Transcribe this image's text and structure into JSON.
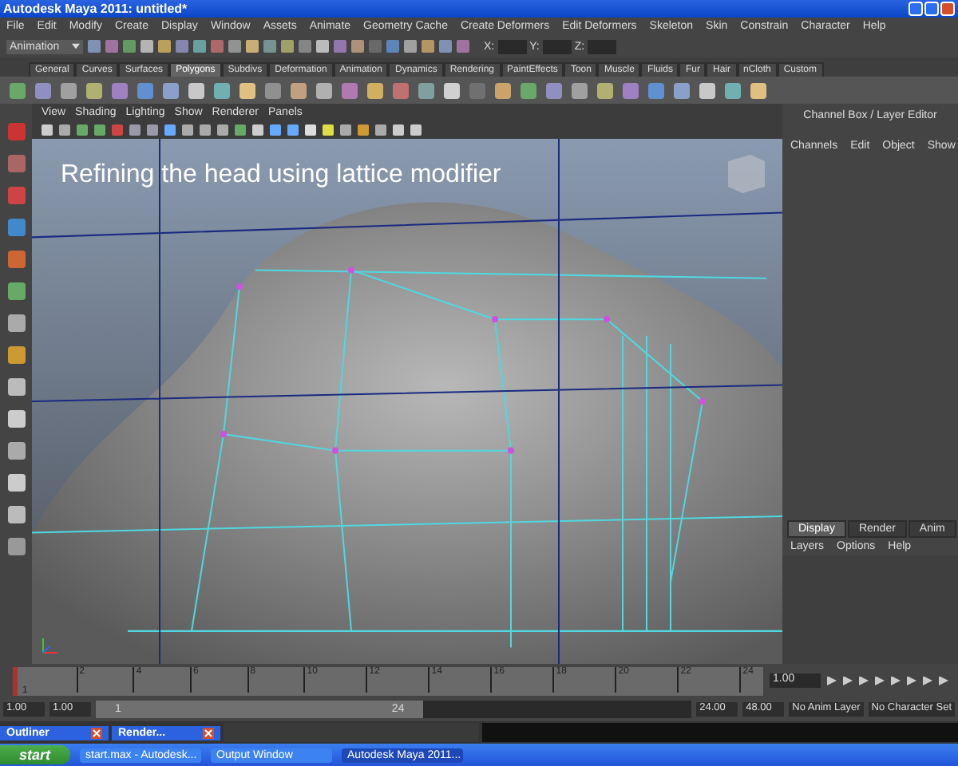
{
  "window": {
    "title": "Autodesk Maya 2011: untitled*"
  },
  "menu": [
    "File",
    "Edit",
    "Modify",
    "Create",
    "Display",
    "Window",
    "Assets",
    "Animate",
    "Geometry Cache",
    "Create Deformers",
    "Edit Deformers",
    "Skeleton",
    "Skin",
    "Constrain",
    "Character",
    "Help"
  ],
  "status_line": {
    "mode": "Animation",
    "fields": [
      "X:",
      "Y:",
      "Z:"
    ]
  },
  "shelf_tabs": [
    {
      "label": "General",
      "selected": false
    },
    {
      "label": "Curves",
      "selected": false
    },
    {
      "label": "Surfaces",
      "selected": false
    },
    {
      "label": "Polygons",
      "selected": true
    },
    {
      "label": "Subdivs",
      "selected": false
    },
    {
      "label": "Deformation",
      "selected": false
    },
    {
      "label": "Animation",
      "selected": false
    },
    {
      "label": "Dynamics",
      "selected": false
    },
    {
      "label": "Rendering",
      "selected": false
    },
    {
      "label": "PaintEffects",
      "selected": false
    },
    {
      "label": "Toon",
      "selected": false
    },
    {
      "label": "Muscle",
      "selected": false
    },
    {
      "label": "Fluids",
      "selected": false
    },
    {
      "label": "Fur",
      "selected": false
    },
    {
      "label": "Hair",
      "selected": false
    },
    {
      "label": "nCloth",
      "selected": false
    },
    {
      "label": "Custom",
      "selected": false
    }
  ],
  "viewport": {
    "menu": [
      "View",
      "Shading",
      "Lighting",
      "Show",
      "Renderer",
      "Panels"
    ],
    "caption": "Refining the head using lattice modifier"
  },
  "channel_box": {
    "title": "Channel Box / Layer Editor",
    "menu": [
      "Channels",
      "Edit",
      "Object",
      "Show"
    ]
  },
  "layer_editor": {
    "tabs": [
      {
        "label": "Display",
        "selected": true
      },
      {
        "label": "Render",
        "selected": false
      },
      {
        "label": "Anim",
        "selected": false
      }
    ],
    "menu": [
      "Layers",
      "Options",
      "Help"
    ]
  },
  "time_slider": {
    "ticks": [
      "2",
      "4",
      "6",
      "8",
      "10",
      "12",
      "14",
      "16",
      "18",
      "20",
      "22",
      "24"
    ],
    "first": "1",
    "current": "1.00",
    "level": 0
  },
  "range": {
    "start": "1.00",
    "anim_start": "1.00",
    "range_start": "1",
    "range_end": "24",
    "level": 0.55,
    "anim_end": "24.00",
    "end": "48.00",
    "anim_layer": "No Anim Layer",
    "character_set": "No Character Set"
  },
  "minimized": [
    {
      "title": "Outliner"
    },
    {
      "title": "Render..."
    }
  ],
  "taskbar": {
    "start": "start",
    "tasks": [
      {
        "label": "start.max - Autodesk...",
        "selected": false
      },
      {
        "label": "Output Window",
        "selected": false
      },
      {
        "label": "Autodesk Maya 2011...",
        "selected": true
      }
    ]
  }
}
